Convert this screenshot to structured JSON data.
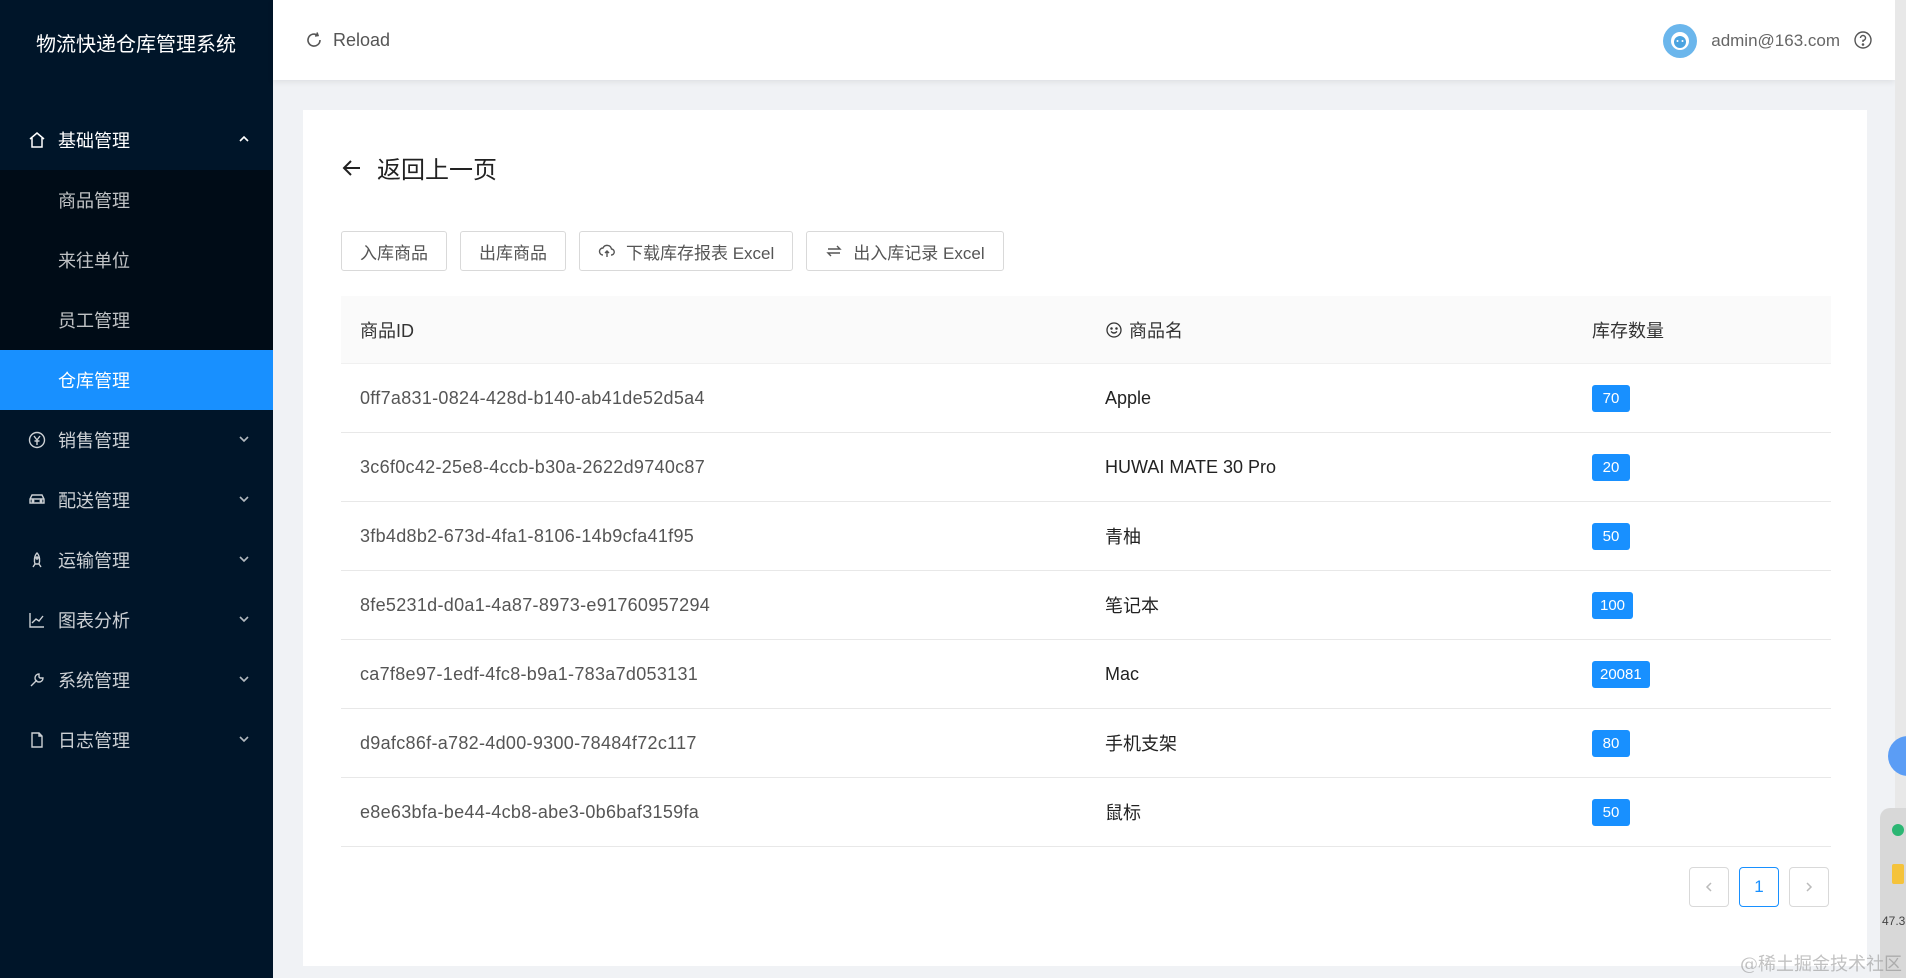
{
  "app_title": "物流快递仓库管理系统",
  "sidebar": {
    "groups": [
      {
        "label": "基础管理",
        "icon": "home-icon",
        "open": true,
        "items": [
          {
            "label": "商品管理"
          },
          {
            "label": "来往单位"
          },
          {
            "label": "员工管理"
          },
          {
            "label": "仓库管理",
            "active": true
          }
        ]
      },
      {
        "label": "销售管理",
        "icon": "yen-icon"
      },
      {
        "label": "配送管理",
        "icon": "car-icon"
      },
      {
        "label": "运输管理",
        "icon": "rocket-icon"
      },
      {
        "label": "图表分析",
        "icon": "line-chart-icon"
      },
      {
        "label": "系统管理",
        "icon": "tool-icon"
      },
      {
        "label": "日志管理",
        "icon": "file-icon"
      }
    ]
  },
  "header": {
    "reload_label": "Reload",
    "user_email": "admin@163.com"
  },
  "page": {
    "back_label": "返回上一页",
    "toolbar": {
      "inbound_label": "入库商品",
      "outbound_label": "出库商品",
      "download_report_label": "下载库存报表 Excel",
      "records_label": "出入库记录 Excel"
    },
    "table": {
      "columns": [
        "商品ID",
        "商品名",
        "库存数量"
      ],
      "rows": [
        {
          "id": "0ff7a831-0824-428d-b140-ab41de52d5a4",
          "name": "Apple",
          "qty": "70"
        },
        {
          "id": "3c6f0c42-25e8-4ccb-b30a-2622d9740c87",
          "name": "HUWAI MATE 30 Pro",
          "qty": "20"
        },
        {
          "id": "3fb4d8b2-673d-4fa1-8106-14b9cfa41f95",
          "name": "青柚",
          "qty": "50"
        },
        {
          "id": "8fe5231d-d0a1-4a87-8973-e91760957294",
          "name": "笔记本",
          "qty": "100"
        },
        {
          "id": "ca7f8e97-1edf-4fc8-b9a1-783a7d053131",
          "name": "Mac",
          "qty": "20081"
        },
        {
          "id": "d9afc86f-a782-4d00-9300-78484f72c117",
          "name": "手机支架",
          "qty": "80"
        },
        {
          "id": "e8e63bfa-be44-4cb8-abe3-0b6baf3159fa",
          "name": "鼠标",
          "qty": "50"
        }
      ]
    },
    "pagination": {
      "current": "1"
    }
  },
  "watermark": "@稀土掘金技术社区",
  "float_panel_text": "47.3",
  "colors": {
    "sidebar_bg": "#001529",
    "accent": "#1890ff"
  }
}
